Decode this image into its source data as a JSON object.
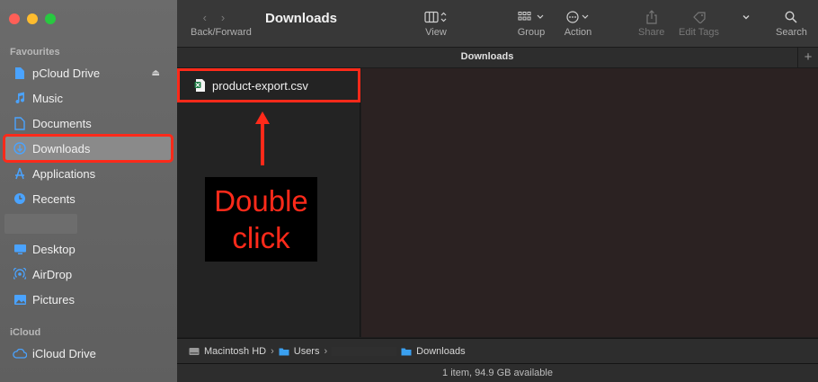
{
  "window": {
    "title": "Downloads"
  },
  "sidebar": {
    "favourites_label": "Favourites",
    "icloud_label": "iCloud",
    "items": [
      {
        "label": "pCloud Drive"
      },
      {
        "label": "Music"
      },
      {
        "label": "Documents"
      },
      {
        "label": "Downloads"
      },
      {
        "label": "Applications"
      },
      {
        "label": "Recents"
      },
      {
        "label": "Desktop"
      },
      {
        "label": "AirDrop"
      },
      {
        "label": "Pictures"
      },
      {
        "label": "iCloud Drive"
      }
    ]
  },
  "toolbar": {
    "back_forward_label": "Back/Forward",
    "view_label": "View",
    "group_label": "Group",
    "action_label": "Action",
    "share_label": "Share",
    "edit_tags_label": "Edit Tags",
    "search_label": "Search"
  },
  "tab": {
    "title": "Downloads",
    "plus": "+"
  },
  "files": [
    {
      "name": "product-export.csv"
    }
  ],
  "annotation": {
    "line1": "Double",
    "line2": "click",
    "color": "#ff2a1a"
  },
  "pathbar": {
    "crumbs": [
      "Macintosh HD",
      "Users",
      "Downloads"
    ],
    "separator": "›"
  },
  "status": {
    "text": "1 item, 94.9 GB available"
  }
}
